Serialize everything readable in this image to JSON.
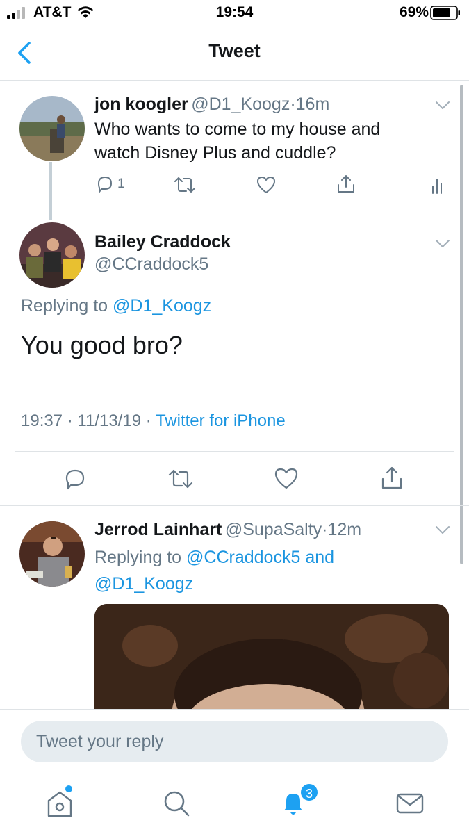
{
  "status_bar": {
    "carrier": "AT&T",
    "time": "19:54",
    "battery": "69%"
  },
  "nav": {
    "title": "Tweet"
  },
  "parent_tweet": {
    "name": "jon koogler",
    "handle": "@D1_Koogz",
    "separator": "·",
    "age": "16m",
    "text": "Who wants to come to my house and watch Disney Plus and cuddle?",
    "reply_count": "1"
  },
  "main_tweet": {
    "name": "Bailey Craddock",
    "handle": "@CCraddock5",
    "replying_prefix": "Replying to",
    "replying_to": "@D1_Koogz",
    "text": "You good bro?",
    "time": "19:37",
    "date": "11/13/19",
    "dot1": "·",
    "dot2": "·",
    "source": "Twitter for iPhone"
  },
  "reply_tweet": {
    "name": "Jerrod Lainhart",
    "handle": "@SupaSalty",
    "separator": "·",
    "age": "12m",
    "replying_prefix": "Replying to",
    "replying_to_1": "@CCraddock5",
    "and": "and",
    "replying_to_2": "@D1_Koogz"
  },
  "reply_box": {
    "placeholder": "Tweet your reply"
  },
  "tab_bar": {
    "notifications_badge": "3"
  },
  "colors": {
    "accent": "#1da1f2",
    "link": "#1b95e0",
    "secondary_text": "#657786",
    "icon_gray": "#657786"
  }
}
